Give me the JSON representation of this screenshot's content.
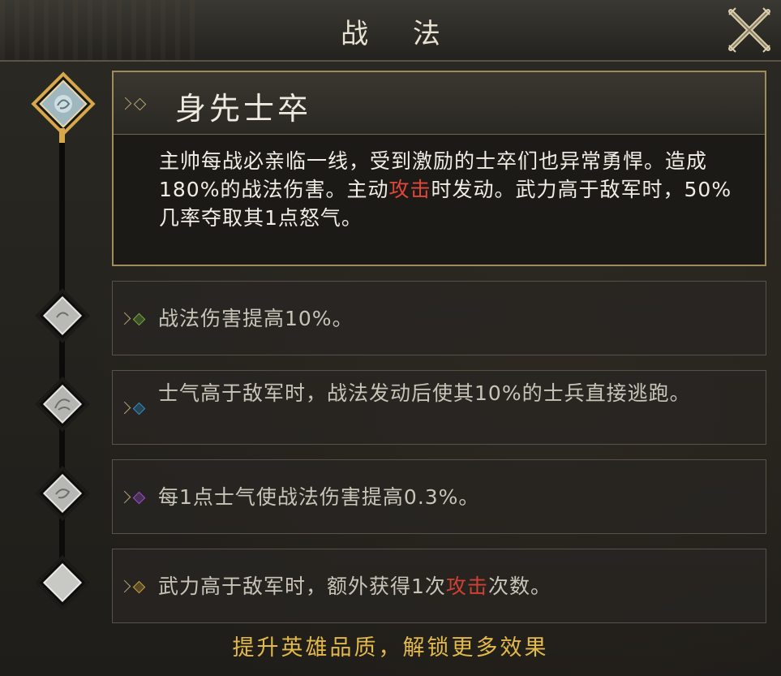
{
  "window": {
    "title": "战 法"
  },
  "skill": {
    "name": "身先士卒",
    "description_parts": [
      "主帅每战必亲临一线，受到激励的士卒们也异常勇悍。造成180%的战法伤害。主动",
      "攻击",
      "时发动。武力高于敌军时，50%几率夺取其1点怒气。"
    ]
  },
  "upgrades": [
    {
      "text": "战法伤害提高10%。",
      "bullet_color": "#6fae3c"
    },
    {
      "text": "士气高于敌军时，战法发动后使其10%的士兵直接逃跑。",
      "bullet_color": "#2f8fc8"
    },
    {
      "text": "每1点士气使战法伤害提高0.3%。",
      "bullet_color": "#9a4fd0"
    },
    {
      "text_parts": [
        "武力高于敌军时，额外获得1次",
        "攻击",
        "次数。"
      ],
      "bullet_color": "#c9a23a"
    }
  ],
  "footer": {
    "label": "提升英雄品质，解锁更多效果"
  },
  "colors": {
    "highlight": "#e0463c",
    "gold": "#e2b94a",
    "frame": "#a08c5a"
  },
  "icons": {
    "close": "close-x-icon",
    "main_node": "skill-emblem-icon",
    "node": "tier-diamond-icon"
  }
}
